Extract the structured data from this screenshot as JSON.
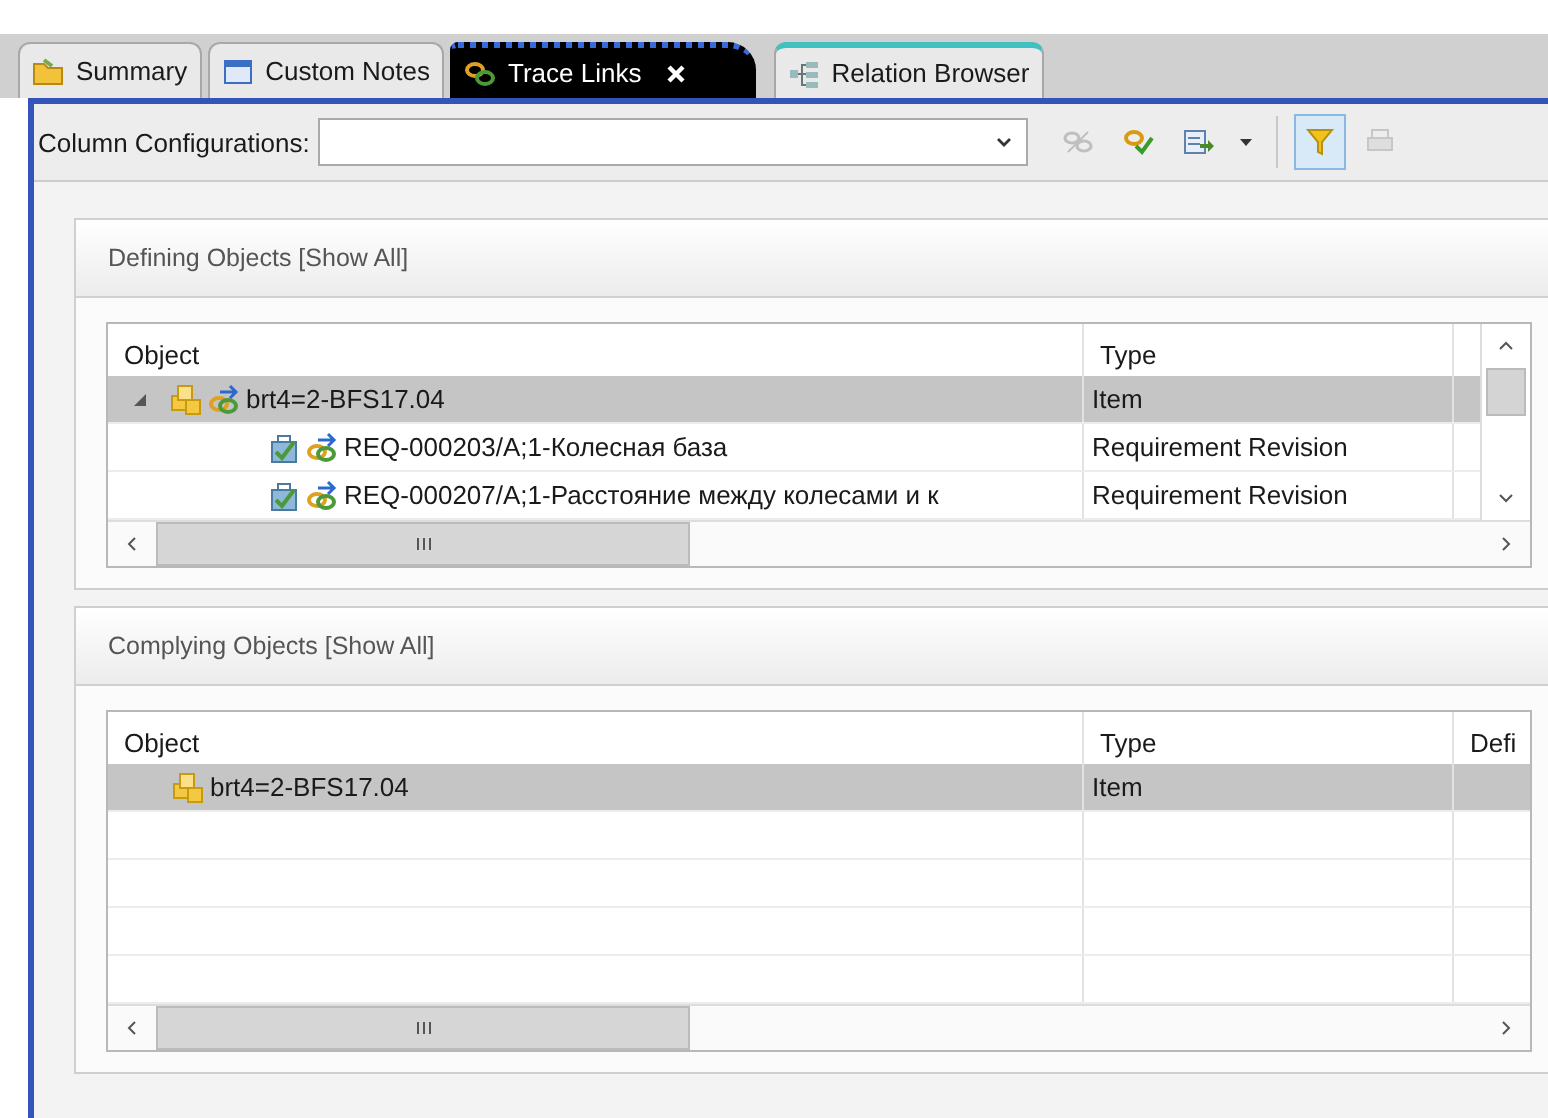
{
  "tabs": [
    {
      "label": "Summary",
      "kind": "summary",
      "selected": false,
      "closable": false
    },
    {
      "label": "Custom Notes",
      "kind": "notes",
      "selected": false,
      "closable": false
    },
    {
      "label": "Trace Links",
      "kind": "trace",
      "selected": true,
      "closable": true
    },
    {
      "label": "Relation Browser",
      "kind": "relation",
      "selected": false,
      "closable": false
    }
  ],
  "toolbar": {
    "label": "Column Configurations:",
    "tools": [
      {
        "kind": "unlink",
        "disabled": true,
        "pressed": false
      },
      {
        "kind": "link",
        "disabled": false,
        "pressed": false
      },
      {
        "kind": "export",
        "disabled": false,
        "pressed": false
      },
      {
        "kind": "dropdown",
        "disabled": false,
        "pressed": false
      },
      {
        "kind": "filter",
        "disabled": false,
        "pressed": true
      },
      {
        "kind": "print",
        "disabled": true,
        "pressed": false
      }
    ]
  },
  "sections": [
    {
      "title": "Defining Objects [Show All]",
      "columns": [
        "Object",
        "Type"
      ],
      "vertical_scroll": true,
      "rows": [
        {
          "object": "brt4=2-BFS17.04",
          "type": "Item",
          "kind": "item",
          "traced": true,
          "selected": true,
          "expanded": true,
          "children": [
            {
              "object": "REQ-000203/A;1-Колесная база",
              "type": "Requirement Revision",
              "kind": "requirement",
              "traced": true,
              "selected": false
            },
            {
              "object": "REQ-000207/A;1-Расстояние между колесами и к",
              "type": "Requirement Revision",
              "kind": "requirement",
              "traced": true,
              "selected": false
            }
          ]
        }
      ]
    },
    {
      "title": "Complying Objects [Show All]",
      "columns": [
        "Object",
        "Type",
        "Defi"
      ],
      "vertical_scroll": false,
      "rows": [
        {
          "object": "brt4=2-BFS17.04",
          "type": "Item",
          "kind": "item",
          "traced": false,
          "selected": true
        }
      ]
    }
  ]
}
